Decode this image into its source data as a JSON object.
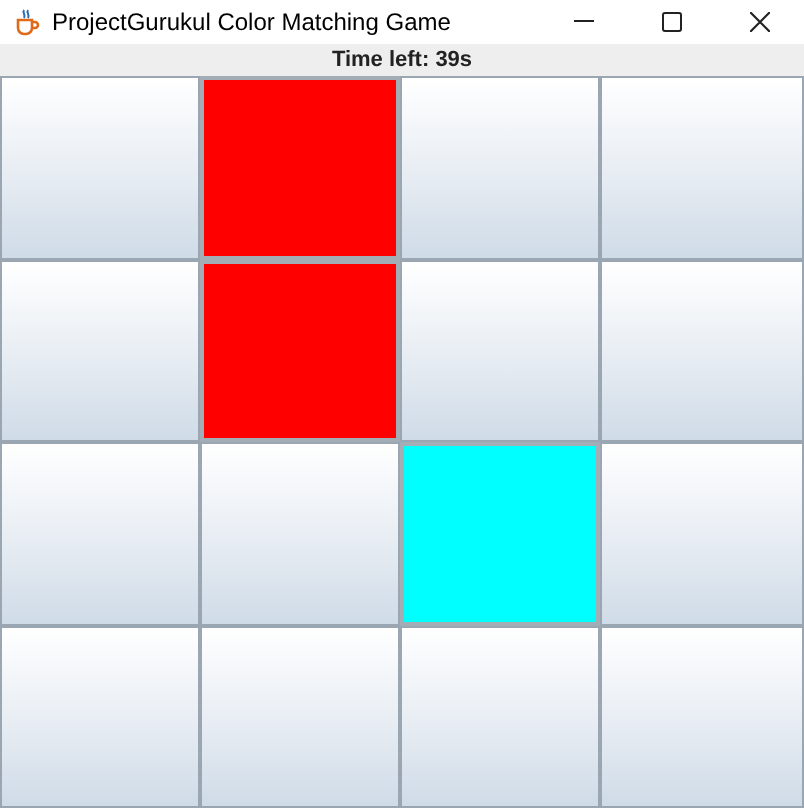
{
  "window": {
    "title": "ProjectGurukul Color Matching Game"
  },
  "timer": {
    "label": "Time left: 39s"
  },
  "tiles": [
    {
      "kind": "hidden"
    },
    {
      "kind": "revealed",
      "color": "#ff0000"
    },
    {
      "kind": "hidden"
    },
    {
      "kind": "hidden"
    },
    {
      "kind": "hidden"
    },
    {
      "kind": "revealed",
      "color": "#ff0000"
    },
    {
      "kind": "hidden"
    },
    {
      "kind": "hidden"
    },
    {
      "kind": "hidden"
    },
    {
      "kind": "hidden"
    },
    {
      "kind": "revealed",
      "color": "#00ffff"
    },
    {
      "kind": "hidden"
    },
    {
      "kind": "hidden"
    },
    {
      "kind": "hidden"
    },
    {
      "kind": "hidden"
    },
    {
      "kind": "hidden"
    }
  ]
}
